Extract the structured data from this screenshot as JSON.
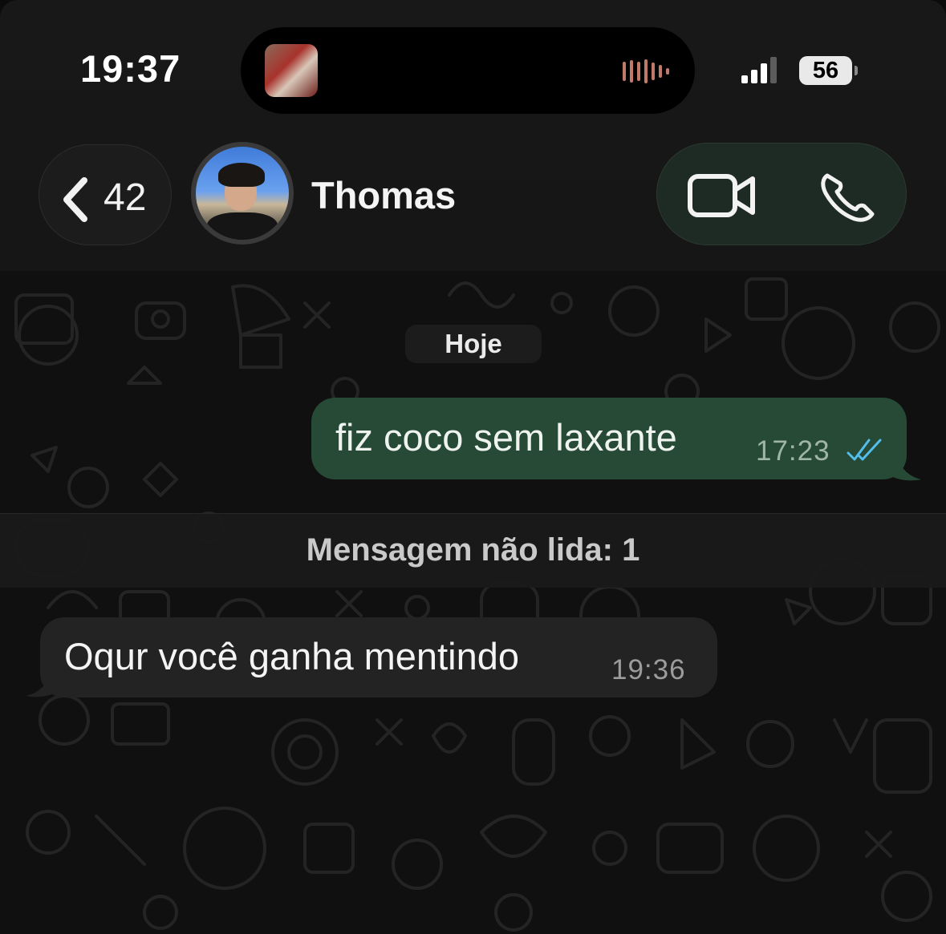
{
  "status_bar": {
    "time": "19:37",
    "battery": "56"
  },
  "header": {
    "back_count": "42",
    "contact_name": "Thomas"
  },
  "chat": {
    "date_separator": "Hoje",
    "messages": [
      {
        "direction": "outgoing",
        "text": "fiz coco sem laxante",
        "time": "17:23",
        "status": "read"
      },
      {
        "direction": "incoming",
        "text": "Oqur você ganha mentindo",
        "time": "19:36"
      }
    ],
    "unread_banner": "Mensagem não lida: 1"
  },
  "colors": {
    "outgoing_bubble": "#264a35",
    "incoming_bubble": "#232323",
    "read_ticks": "#53bdeb",
    "call_pill": "#1e2a24"
  },
  "icons": [
    "chevron-left-icon",
    "video-call-icon",
    "phone-icon",
    "signal-icon",
    "battery-icon",
    "double-check-icon",
    "audio-wave-icon"
  ]
}
